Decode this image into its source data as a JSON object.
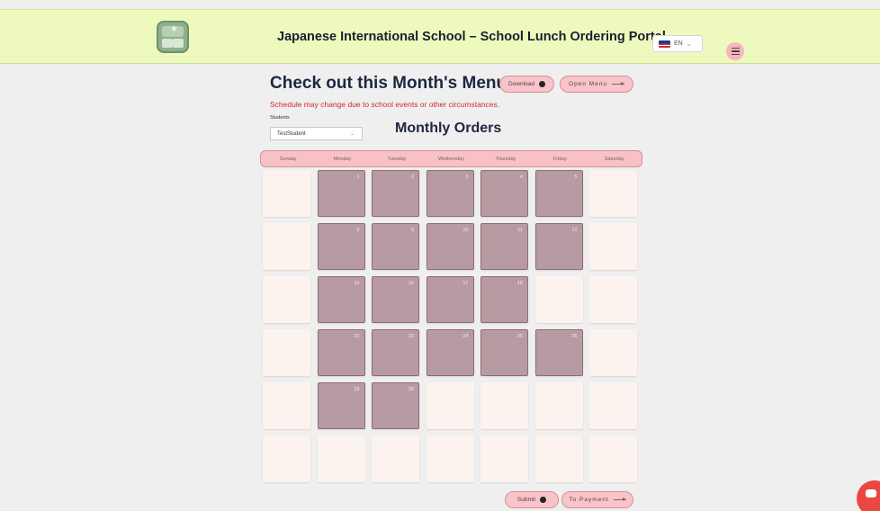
{
  "header": {
    "title": "Japanese International School – School Lunch Ordering Portal",
    "language": "EN",
    "logo_icon": "school-lunch-logo-icon",
    "menu_icon": "hamburger-menu-icon"
  },
  "menu_section": {
    "heading": "Check out this Month's Menu:",
    "download_label": "Download",
    "open_menu_label": "Open Menu",
    "notice": "Schedule may change due to school events or other circumstances."
  },
  "students": {
    "label": "Students",
    "selected": "TestStudent"
  },
  "calendar": {
    "title": "Monthly Orders",
    "weekdays": [
      "Sunday",
      "Monday",
      "Tuesday",
      "Wednesday",
      "Thursday",
      "Friday",
      "Saturday"
    ],
    "cells": [
      {
        "day": "",
        "school": false
      },
      {
        "day": "1",
        "school": true
      },
      {
        "day": "2",
        "school": true
      },
      {
        "day": "3",
        "school": true
      },
      {
        "day": "4",
        "school": true
      },
      {
        "day": "5",
        "school": true
      },
      {
        "day": "",
        "school": false
      },
      {
        "day": "",
        "school": false
      },
      {
        "day": "8",
        "school": true
      },
      {
        "day": "9",
        "school": true
      },
      {
        "day": "10",
        "school": true
      },
      {
        "day": "11",
        "school": true
      },
      {
        "day": "12",
        "school": true
      },
      {
        "day": "",
        "school": false
      },
      {
        "day": "",
        "school": false
      },
      {
        "day": "15",
        "school": true
      },
      {
        "day": "16",
        "school": true
      },
      {
        "day": "17",
        "school": true
      },
      {
        "day": "18",
        "school": true
      },
      {
        "day": "",
        "school": false
      },
      {
        "day": "",
        "school": false
      },
      {
        "day": "",
        "school": false
      },
      {
        "day": "22",
        "school": true
      },
      {
        "day": "23",
        "school": true
      },
      {
        "day": "24",
        "school": true
      },
      {
        "day": "25",
        "school": true
      },
      {
        "day": "26",
        "school": true
      },
      {
        "day": "",
        "school": false
      },
      {
        "day": "",
        "school": false
      },
      {
        "day": "29",
        "school": true
      },
      {
        "day": "30",
        "school": true
      },
      {
        "day": "",
        "school": false
      },
      {
        "day": "",
        "school": false
      },
      {
        "day": "",
        "school": false
      },
      {
        "day": "",
        "school": false
      },
      {
        "day": "",
        "school": false
      },
      {
        "day": "",
        "school": false
      },
      {
        "day": "",
        "school": false
      },
      {
        "day": "",
        "school": false
      },
      {
        "day": "",
        "school": false
      },
      {
        "day": "",
        "school": false
      },
      {
        "day": "",
        "school": false
      }
    ]
  },
  "footer": {
    "submit_label": "Submit",
    "payment_label": "To Payment"
  },
  "colors": {
    "header_bg": "#eefabd",
    "accent_pink": "#f7c4c9",
    "school_day": "#b89ba2",
    "empty_day": "#fdf3ee",
    "notice_red": "#d22a2a",
    "chat_red": "#e9473f"
  }
}
